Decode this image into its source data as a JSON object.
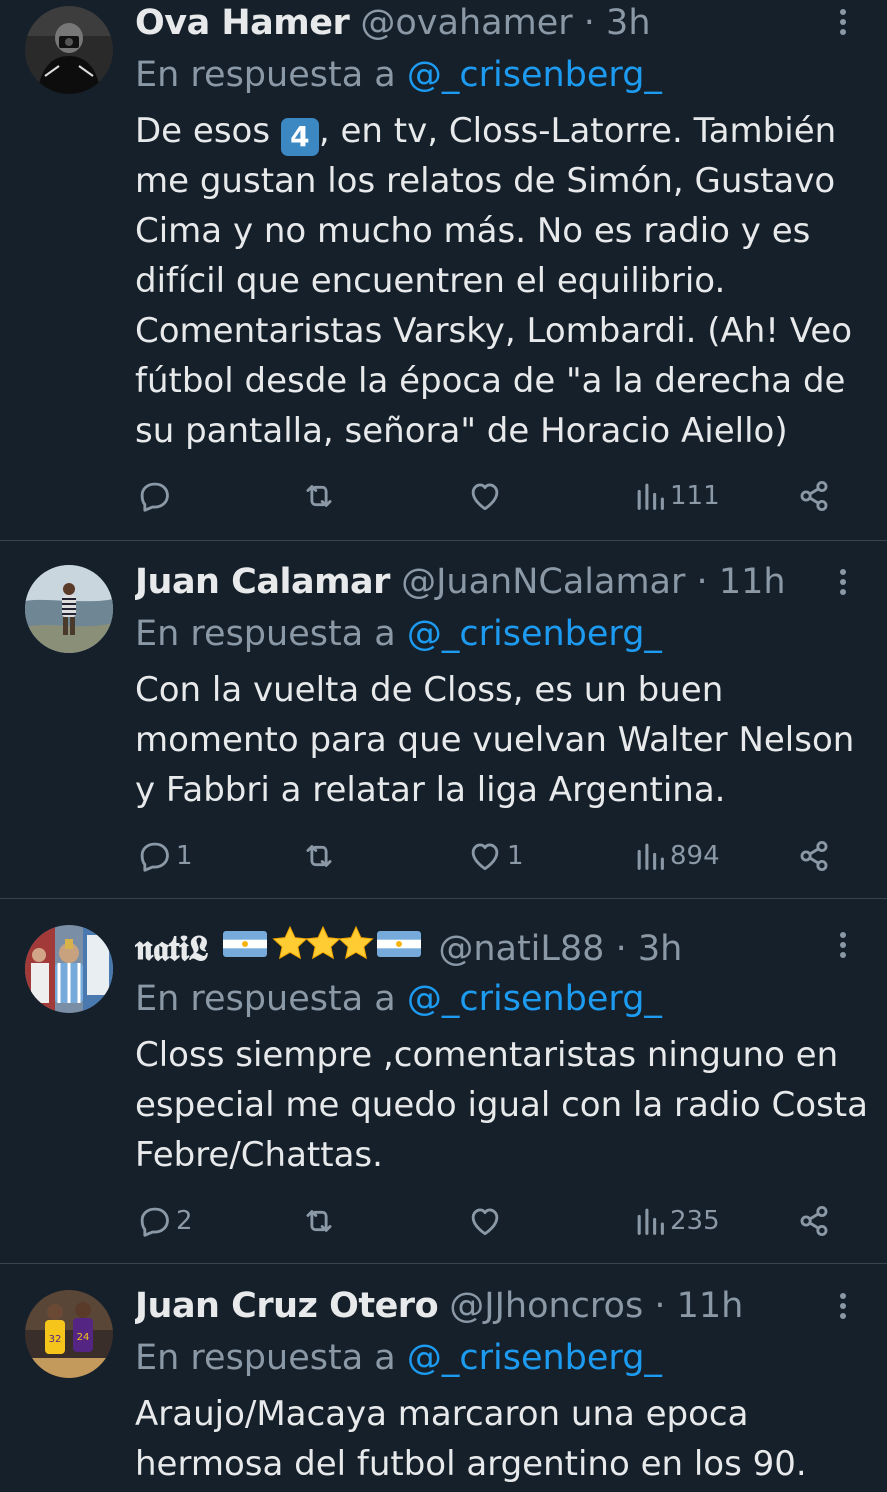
{
  "tweets": [
    {
      "name": "Ova Hamer",
      "handle": "@ovahamer",
      "sep": "·",
      "time": "3h",
      "reply_prefix": "En respuesta a ",
      "reply_to": "@_crisenberg_",
      "text_pre": "De esos ",
      "keycap": "4",
      "text_post": ", en tv, Closs-Latorre. También me gustan los relatos de Simón, Gustavo Cima y no mucho más. No es radio y es difícil que encuentren el equilibrio. Comentaristas Varsky, Lombardi. (Ah! Veo fútbol desde la época de \"a la derecha de su pantalla, señora\" de Horacio Aiello)",
      "replies": "",
      "retweets": "",
      "likes": "",
      "views": "111"
    },
    {
      "name": "Juan Calamar",
      "handle": "@JuanNCalamar",
      "sep": "·",
      "time": "11h",
      "reply_prefix": "En respuesta a ",
      "reply_to": "@_crisenberg_",
      "text": "Con la vuelta de Closs, es un buen momento para que vuelvan Walter Nelson y Fabbri a relatar la liga Argentina.",
      "replies": "1",
      "retweets": "",
      "likes": "1",
      "views": "894"
    },
    {
      "name": "𝖓𝖆𝖙𝖎𝕷",
      "handle": "@natiL88",
      "sep": "·",
      "time": "3h",
      "reply_prefix": "En respuesta a ",
      "reply_to": "@_crisenberg_",
      "text": "Closs siempre ,comentaristas ninguno en especial me quedo igual con la radio Costa Febre/Chattas.",
      "replies": "2",
      "retweets": "",
      "likes": "",
      "views": "235"
    },
    {
      "name": "Juan Cruz Otero",
      "handle": "@JJhoncros",
      "sep": "·",
      "time": "11h",
      "reply_prefix": "En respuesta a ",
      "reply_to": "@_crisenberg_",
      "text": "Araujo/Macaya marcaron una epoca hermosa del futbol argentino en los 90."
    }
  ],
  "colors": {
    "background": "#15202b",
    "text": "#e7e9ea",
    "muted": "#8b98a5",
    "link": "#1d9bf0",
    "divider": "#38444d"
  },
  "icons": [
    "reply-icon",
    "retweet-icon",
    "like-icon",
    "views-icon",
    "share-icon",
    "more-icon"
  ]
}
